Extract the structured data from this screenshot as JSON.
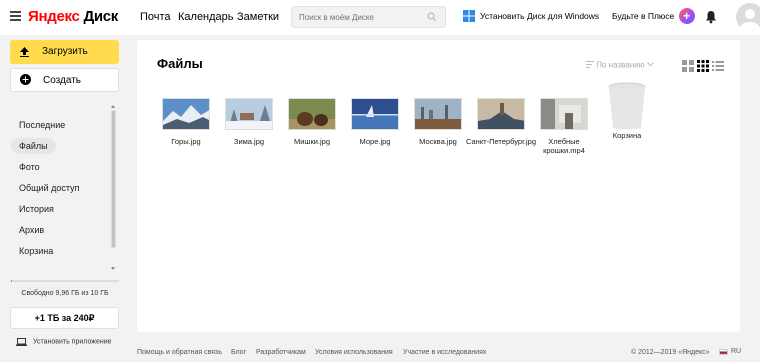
{
  "header": {
    "logo_ya": "Яндекс",
    "logo_disk": "Диск",
    "nav": [
      "Почта",
      "Календарь",
      "Заметки"
    ],
    "search_placeholder": "Поиск в моём Диске",
    "install_windows": "Установить Диск для Windows",
    "plus_label": "Будьте в Плюсе",
    "plus_badge": "+"
  },
  "sidebar": {
    "upload_label": "Загрузить",
    "create_label": "Создать",
    "items": [
      {
        "label": "Последние",
        "active": false
      },
      {
        "label": "Файлы",
        "active": true
      },
      {
        "label": "Фото",
        "active": false
      },
      {
        "label": "Общий доступ",
        "active": false
      },
      {
        "label": "История",
        "active": false
      },
      {
        "label": "Архив",
        "active": false
      },
      {
        "label": "Корзина",
        "active": false
      }
    ],
    "storage_text": "Свободно 9,96 ГБ из 10 ГБ",
    "storage_used_fraction": 0.004,
    "tb_offer": "+1 ТБ за 240₽",
    "install_app": "Установить приложение"
  },
  "main": {
    "title": "Файлы",
    "sort_label": "По названию",
    "files": [
      {
        "name": "Горы.jpg",
        "thumb": "mountains"
      },
      {
        "name": "Зима.jpg",
        "thumb": "winter"
      },
      {
        "name": "Мишки.jpg",
        "thumb": "bears"
      },
      {
        "name": "Море.jpg",
        "thumb": "sea"
      },
      {
        "name": "Москва.jpg",
        "thumb": "moscow"
      },
      {
        "name": "Санкт-Петербург.jpg",
        "thumb": "spb"
      },
      {
        "name": "Хлебные крошки.mp4",
        "thumb": "breadcrumbs"
      }
    ],
    "trash_label": "Корзина"
  },
  "footer": {
    "links": [
      "Помощь и обратная связь",
      "Блог",
      "Разработчикам",
      "Условия использования",
      "Участие в исследованиях"
    ],
    "copyright": "© 2012—2019 «Яндекс»",
    "lang": "RU"
  },
  "colors": {
    "accent_yellow": "#ffdb4d",
    "logo_red": "#ff0000",
    "windows_blue": "#2d8ae5"
  }
}
